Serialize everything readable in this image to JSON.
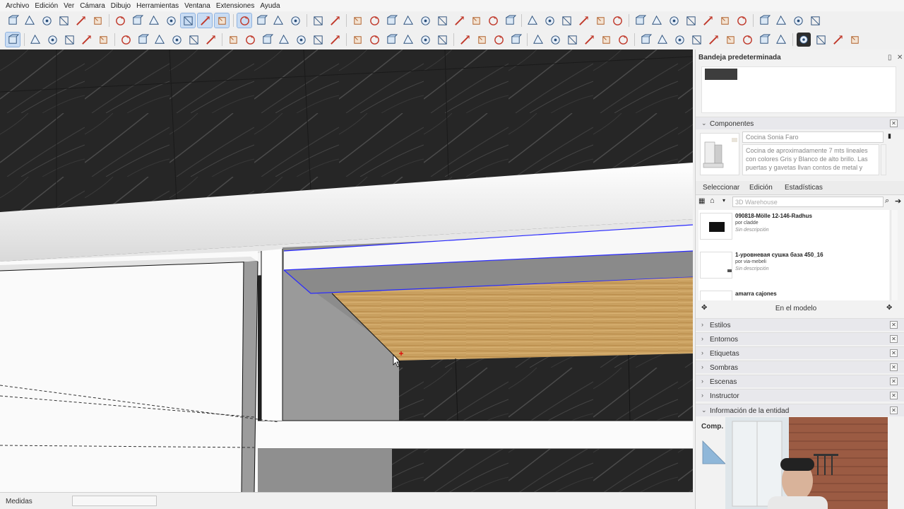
{
  "menu": [
    "Archivo",
    "Edición",
    "Ver",
    "Cámara",
    "Dibujo",
    "Herramientas",
    "Ventana",
    "Extensiones",
    "Ayuda"
  ],
  "toolbar1_icons": [
    "iso-view-icon",
    "top-view-icon",
    "front-view-icon",
    "right-view-icon",
    "back-view-icon",
    "left-view-icon",
    "xray-icon",
    "back-edges-icon",
    "wireframe-icon",
    "hidden-line-icon",
    "shaded-icon",
    "shaded-textures-icon",
    "monochrome-icon",
    "section-plane-icon",
    "section-cut-icon",
    "section-fill-icon",
    "section-display-icon",
    "component-icon",
    "group-icon",
    "orbit-icon",
    "pan-icon",
    "zoom-icon",
    "zoom-window-icon",
    "zoom-extents-icon",
    "prev-view-icon",
    "next-view-icon",
    "position-camera-icon",
    "walk-icon",
    "look-around-icon",
    "solid-union-icon",
    "solid-subtract-icon",
    "solid-trim-icon",
    "solid-intersect-icon",
    "solid-split-icon",
    "outer-shell-icon",
    "sandbox-contours-icon",
    "sandbox-scratch-icon",
    "sandbox-smoove-icon",
    "sandbox-stamp-icon",
    "sandbox-drape-icon",
    "sandbox-add-detail-icon",
    "sandbox-flip-edge-icon",
    "warehouse-icon",
    "extension-warehouse-icon",
    "layout-icon",
    "extension-manager-icon"
  ],
  "toolbar2_icons": [
    "select-icon",
    "eraser-icon",
    "pencil-icon",
    "line-icon",
    "arc-icon",
    "rectangle-icon",
    "push-pull-icon",
    "follow-me-icon",
    "move-icon",
    "rotate-icon",
    "scale-icon",
    "offset-icon",
    "tape-measure-icon",
    "protractor-icon",
    "dimension-icon",
    "text-icon",
    "axes-icon",
    "3d-text-icon",
    "paint-bucket-icon",
    "orbit2-icon",
    "pan2-icon",
    "zoom2-icon",
    "zoom-extents2-icon",
    "walk2-icon",
    "look2-icon",
    "section2-icon",
    "shadows-icon",
    "fog-icon",
    "match-photo-icon",
    "geo-location-icon",
    "terrain-icon",
    "add-location-icon",
    "photo-texture-icon",
    "sun-icon",
    "ruby-console-icon",
    "styles-icon",
    "generic-tool-icon",
    "plugin-a-icon",
    "plugin-b-icon",
    "plugin-c-icon",
    "plugin-d-icon",
    "plugin-e-icon",
    "plugin-f-icon",
    "plugin-g-icon",
    "opencutlist-icon",
    "plugin-h-icon",
    "plugin-i-icon",
    "plugin-j-icon"
  ],
  "tray": {
    "title": "Bandeja predeterminada",
    "panels": {
      "components": "Componentes",
      "styles": "Estilos",
      "environments": "Entornos",
      "tags": "Etiquetas",
      "shadows": "Sombras",
      "scenes": "Escenas",
      "instructor": "Instructor",
      "entity_info": "Información de la entidad"
    }
  },
  "components": {
    "name": "Cocina Sonia Faro",
    "description": "Cocina de aproximadamente 7 mts lineales con colores Gris y Blanco de alto brillo. Las puertas y gavetas llvan contos de metal y",
    "tabs": [
      "Seleccionar",
      "Edición",
      "Estadísticas"
    ],
    "search_placeholder": "3D Warehouse",
    "results": [
      {
        "name": "090818-Mölle 12-146-Radhus",
        "author": "por cladde",
        "desc": "Sin descripción"
      },
      {
        "name": "1-уровневая сушка база 450_16",
        "author": "por via-mebeli",
        "desc": "Sin descripción"
      },
      {
        "name": "amarra cajones",
        "author": "",
        "desc": ""
      }
    ],
    "in_model": "En el modelo"
  },
  "entity_info": {
    "label": "Comp. s"
  },
  "status": {
    "measure_label": "Medidas",
    "measure_value": ""
  },
  "colors": {
    "selection_blue": "#2a2aff",
    "wood_light": "#c79a52",
    "dark_wood": "#2b2b2b",
    "panel_gray": "#8e8e8e",
    "white_panel": "#fafafa"
  }
}
